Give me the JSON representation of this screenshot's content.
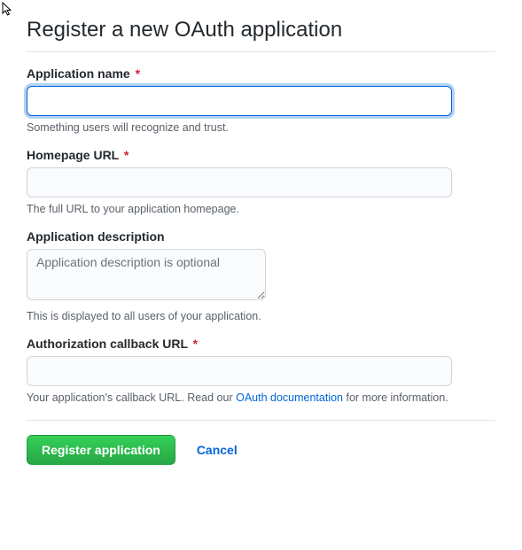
{
  "header": {
    "title": "Register a new OAuth application"
  },
  "fields": {
    "app_name": {
      "label": "Application name",
      "required": "*",
      "value": "",
      "hint": "Something users will recognize and trust."
    },
    "homepage": {
      "label": "Homepage URL",
      "required": "*",
      "value": "",
      "hint": "The full URL to your application homepage."
    },
    "description": {
      "label": "Application description",
      "placeholder": "Application description is optional",
      "value": "",
      "hint": "This is displayed to all users of your application."
    },
    "callback": {
      "label": "Authorization callback URL",
      "required": "*",
      "value": "",
      "hint_prefix": "Your application's callback URL. Read our ",
      "hint_link": "OAuth documentation",
      "hint_suffix": " for more information."
    }
  },
  "actions": {
    "submit": "Register application",
    "cancel": "Cancel"
  }
}
